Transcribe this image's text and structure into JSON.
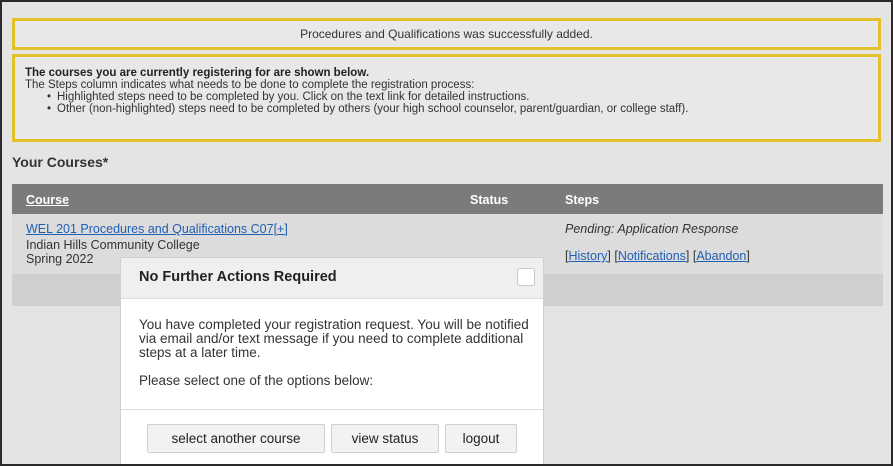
{
  "success_message": "Procedures and Qualifications was successfully added.",
  "info": {
    "headline": "The courses you are currently registering for are shown below.",
    "description": "The Steps column indicates what needs to be done to complete the registration process:",
    "bullets": [
      "Highlighted steps need to be completed by you. Click on the text link for detailed instructions.",
      "Other (non-highlighted) steps need to be completed by others (your high school counselor, parent/guardian, or college staff)."
    ]
  },
  "section_title": "Your Courses*",
  "table": {
    "headers": {
      "course": "Course",
      "status": "Status",
      "steps": "Steps"
    },
    "row": {
      "course_link": "WEL 201 Procedures and Qualifications C07[+]",
      "school": "Indian Hills Community College",
      "term": "Spring 2022",
      "status": "",
      "pending": "Pending: Application Response",
      "actions": {
        "history": "History",
        "notifications": "Notifications",
        "abandon": "Abandon"
      }
    }
  },
  "modal": {
    "title": "No Further Actions Required",
    "message": "You have completed your registration request. You will be notified via email and/or text message if you need to complete additional steps at a later time.",
    "prompt": "Please select one of the options below:",
    "buttons": {
      "select_another": "select another course",
      "view_status": "view status",
      "logout": "logout"
    }
  },
  "colors": {
    "highlight_border": "#e3c12b",
    "link": "#1f5fb4",
    "header_bg": "#7b7b7b"
  }
}
